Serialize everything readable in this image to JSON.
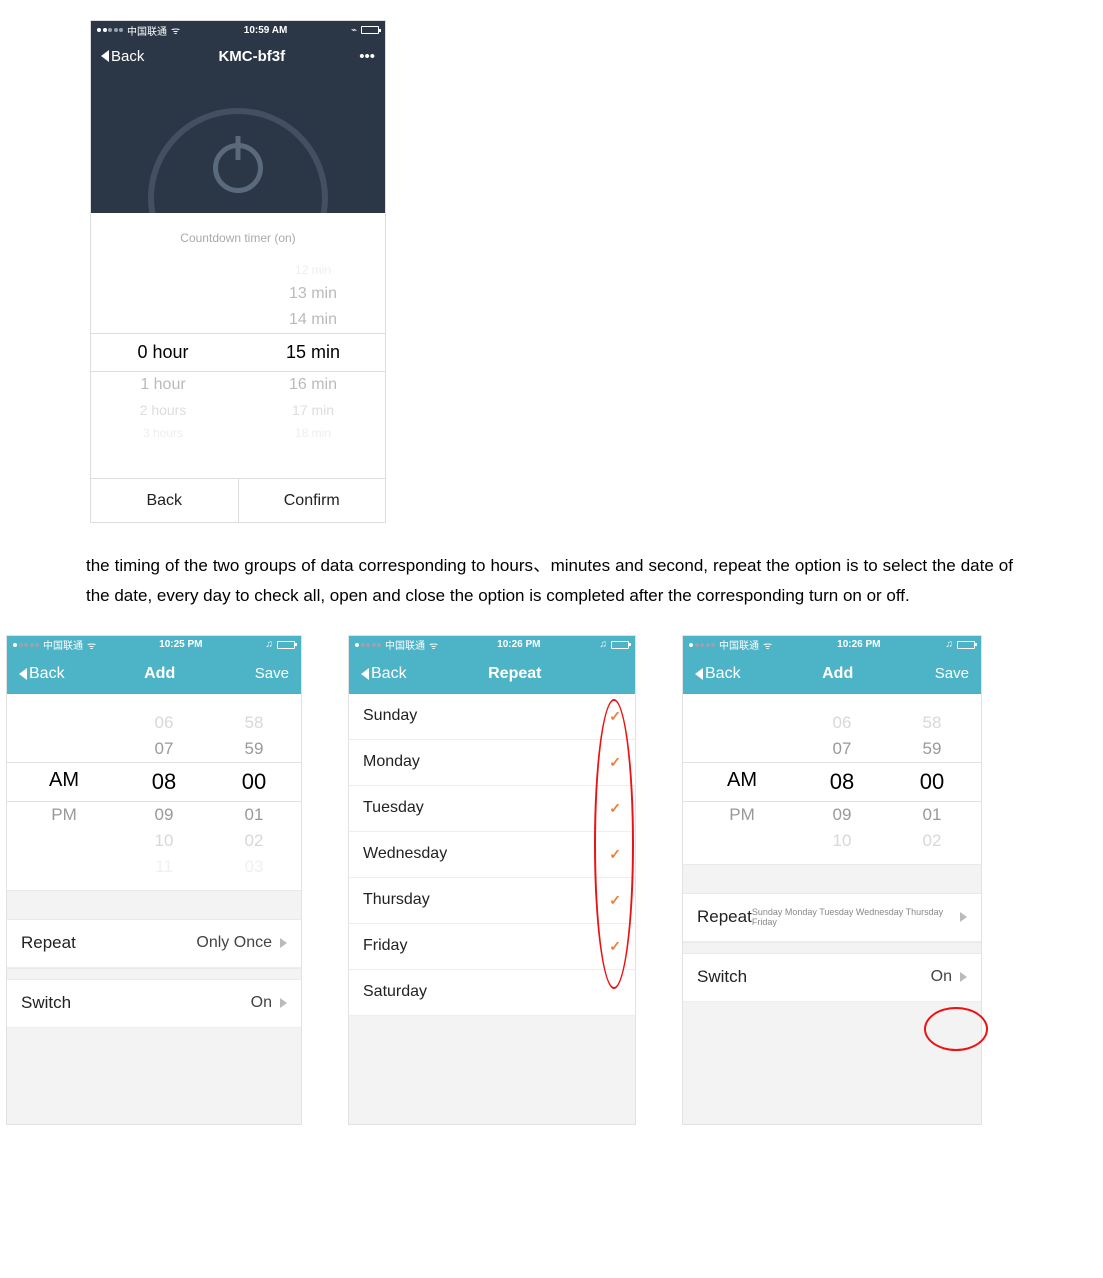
{
  "shot1": {
    "status": {
      "carrier": "中国联通",
      "time": "10:59 AM"
    },
    "nav": {
      "back": "Back",
      "title": "KMC-bf3f",
      "more": "•••"
    },
    "sheet_title": "Countdown timer (on)",
    "hours": {
      "above2": "",
      "above1": "",
      "sel": "0 hour",
      "below1": "1 hour",
      "below2": "2 hours",
      "below3": "3 hours"
    },
    "mins": {
      "above3": "12 min",
      "above2": "13 min",
      "above1": "14 min",
      "sel": "15 min",
      "below1": "16 min",
      "below2": "17 min",
      "below3": "18 min"
    },
    "actions": {
      "back": "Back",
      "confirm": "Confirm"
    }
  },
  "paragraph": "the timing of the two groups of data corresponding to hours、minutes and second, repeat the option is to select the date of the date, every day to check all, open and close the option is completed after the corresponding turn on or off.",
  "phoneA": {
    "status": {
      "carrier": "中国联通",
      "time": "10:25 PM"
    },
    "nav": {
      "back": "Back",
      "title": "Add",
      "save": "Save"
    },
    "picker": {
      "ampm": {
        "sel": "AM",
        "below": "PM"
      },
      "hour": {
        "a3": "",
        "a2": "06",
        "a1": "07",
        "sel": "08",
        "b1": "09",
        "b2": "10",
        "b3": "11"
      },
      "min": {
        "a3": "",
        "a2": "58",
        "a1": "59",
        "sel": "00",
        "b1": "01",
        "b2": "02",
        "b3": "03"
      }
    },
    "rows": {
      "repeat_label": "Repeat",
      "repeat_value": "Only Once",
      "switch_label": "Switch",
      "switch_value": "On"
    }
  },
  "phoneB": {
    "status": {
      "carrier": "中国联通",
      "time": "10:26 PM"
    },
    "nav": {
      "back": "Back",
      "title": "Repeat"
    },
    "days": [
      {
        "name": "Sunday",
        "checked": true
      },
      {
        "name": "Monday",
        "checked": true
      },
      {
        "name": "Tuesday",
        "checked": true
      },
      {
        "name": "Wednesday",
        "checked": true
      },
      {
        "name": "Thursday",
        "checked": true
      },
      {
        "name": "Friday",
        "checked": true
      },
      {
        "name": "Saturday",
        "checked": false
      }
    ]
  },
  "phoneC": {
    "status": {
      "carrier": "中国联通",
      "time": "10:26 PM"
    },
    "nav": {
      "back": "Back",
      "title": "Add",
      "save": "Save"
    },
    "picker": {
      "ampm": {
        "sel": "AM",
        "below": "PM"
      },
      "hour": {
        "a2": "06",
        "a1": "07",
        "sel": "08",
        "b1": "09",
        "b2": "10"
      },
      "min": {
        "a2": "58",
        "a1": "59",
        "sel": "00",
        "b1": "01",
        "b2": "02"
      }
    },
    "rows": {
      "repeat_label": "Repeat",
      "repeat_value": "Sunday Monday Tuesday Wednesday Thursday Friday",
      "switch_label": "Switch",
      "switch_value": "On"
    }
  }
}
